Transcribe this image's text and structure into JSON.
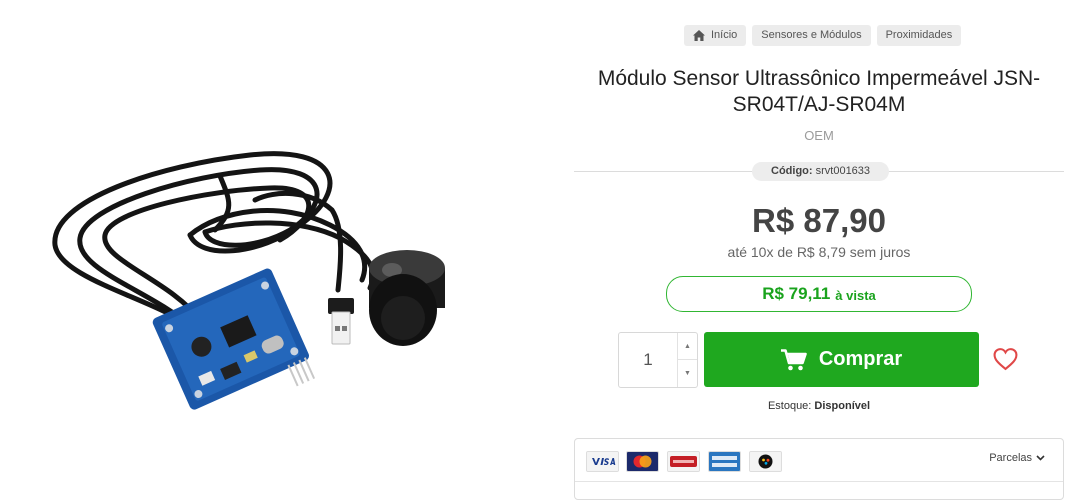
{
  "breadcrumb": {
    "home": "Início",
    "category": "Sensores e Módulos",
    "subcategory": "Proximidades"
  },
  "product": {
    "title": "Módulo Sensor Ultrassônico Impermeável JSN-SR04T/AJ-SR04M",
    "brand": "OEM",
    "code_label": "Código:",
    "code_value": "srvt001633",
    "price": "R$ 87,90",
    "installments": "até 10x de R$ 8,79 sem juros",
    "cash_price": "R$ 79,11",
    "cash_label": "à vista",
    "quantity": "1",
    "buy_label": "Comprar",
    "stock_label": "Estoque:",
    "stock_value": "Disponível"
  },
  "payment": {
    "cards": [
      "visa",
      "mastercard",
      "hipercard",
      "american-express",
      "elo"
    ],
    "parcelas_label": "Parcelas"
  },
  "colors": {
    "buy_button": "#1fa81f",
    "cash_green": "#1aa31d",
    "wishlist": "#e04848"
  },
  "icons": {
    "home": "home-icon",
    "cart": "cart-icon",
    "wishlist": "heart-icon",
    "dropdown": "chevron-down-icon"
  }
}
